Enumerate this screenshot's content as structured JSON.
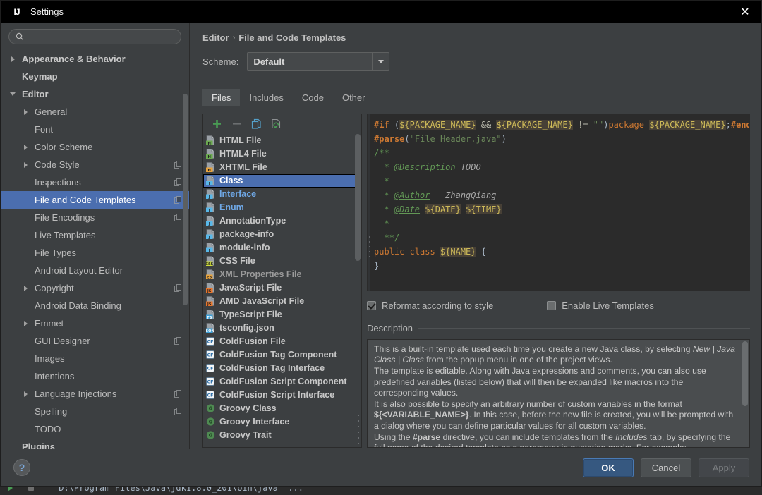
{
  "window": {
    "title": "Settings",
    "logo_text": "IJ",
    "close_icon": "close-icon"
  },
  "sidebar": {
    "search": {
      "value": "",
      "placeholder": ""
    },
    "items": [
      {
        "label": "Appearance & Behavior",
        "arrow": "right",
        "indent": 0,
        "bold": true,
        "copy": false,
        "selected": false
      },
      {
        "label": "Keymap",
        "arrow": "none",
        "indent": 0,
        "bold": true,
        "copy": false,
        "selected": false
      },
      {
        "label": "Editor",
        "arrow": "down",
        "indent": 0,
        "bold": true,
        "copy": false,
        "selected": false
      },
      {
        "label": "General",
        "arrow": "right",
        "indent": 1,
        "bold": false,
        "copy": false,
        "selected": false
      },
      {
        "label": "Font",
        "arrow": "none",
        "indent": 1,
        "bold": false,
        "copy": false,
        "selected": false
      },
      {
        "label": "Color Scheme",
        "arrow": "right",
        "indent": 1,
        "bold": false,
        "copy": false,
        "selected": false
      },
      {
        "label": "Code Style",
        "arrow": "right",
        "indent": 1,
        "bold": false,
        "copy": true,
        "selected": false
      },
      {
        "label": "Inspections",
        "arrow": "none",
        "indent": 1,
        "bold": false,
        "copy": true,
        "selected": false
      },
      {
        "label": "File and Code Templates",
        "arrow": "none",
        "indent": 1,
        "bold": false,
        "copy": true,
        "selected": true
      },
      {
        "label": "File Encodings",
        "arrow": "none",
        "indent": 1,
        "bold": false,
        "copy": true,
        "selected": false
      },
      {
        "label": "Live Templates",
        "arrow": "none",
        "indent": 1,
        "bold": false,
        "copy": false,
        "selected": false
      },
      {
        "label": "File Types",
        "arrow": "none",
        "indent": 1,
        "bold": false,
        "copy": false,
        "selected": false
      },
      {
        "label": "Android Layout Editor",
        "arrow": "none",
        "indent": 1,
        "bold": false,
        "copy": false,
        "selected": false
      },
      {
        "label": "Copyright",
        "arrow": "right",
        "indent": 1,
        "bold": false,
        "copy": true,
        "selected": false
      },
      {
        "label": "Android Data Binding",
        "arrow": "none",
        "indent": 1,
        "bold": false,
        "copy": false,
        "selected": false
      },
      {
        "label": "Emmet",
        "arrow": "right",
        "indent": 1,
        "bold": false,
        "copy": false,
        "selected": false
      },
      {
        "label": "GUI Designer",
        "arrow": "none",
        "indent": 1,
        "bold": false,
        "copy": true,
        "selected": false
      },
      {
        "label": "Images",
        "arrow": "none",
        "indent": 1,
        "bold": false,
        "copy": false,
        "selected": false
      },
      {
        "label": "Intentions",
        "arrow": "none",
        "indent": 1,
        "bold": false,
        "copy": false,
        "selected": false
      },
      {
        "label": "Language Injections",
        "arrow": "right",
        "indent": 1,
        "bold": false,
        "copy": true,
        "selected": false
      },
      {
        "label": "Spelling",
        "arrow": "none",
        "indent": 1,
        "bold": false,
        "copy": true,
        "selected": false
      },
      {
        "label": "TODO",
        "arrow": "none",
        "indent": 1,
        "bold": false,
        "copy": false,
        "selected": false
      },
      {
        "label": "Plugins",
        "arrow": "none",
        "indent": 0,
        "bold": true,
        "copy": false,
        "selected": false
      }
    ]
  },
  "header": {
    "breadcrumb_parent": "Editor",
    "breadcrumb_sep": "›",
    "breadcrumb_current": "File and Code Templates",
    "scheme_label": "Scheme:",
    "scheme_value": "Default",
    "scheme_arrow_icon": "chevron-down-icon"
  },
  "tabs": [
    {
      "label": "Files",
      "active": true
    },
    {
      "label": "Includes",
      "active": false
    },
    {
      "label": "Code",
      "active": false
    },
    {
      "label": "Other",
      "active": false
    }
  ],
  "list_toolbar": [
    {
      "name": "add-template-button",
      "icon": "plus-icon",
      "enabled": true
    },
    {
      "name": "remove-template-button",
      "icon": "minus-icon",
      "enabled": false
    },
    {
      "name": "copy-template-button",
      "icon": "copy-icon",
      "enabled": true
    },
    {
      "name": "reset-template-button",
      "icon": "reset-icon",
      "enabled": true
    }
  ],
  "templates": [
    {
      "label": "HTML File",
      "icon": "html-file-icon",
      "state": "normal",
      "selected": false
    },
    {
      "label": "HTML4 File",
      "icon": "html-file-icon",
      "state": "normal",
      "selected": false
    },
    {
      "label": "XHTML File",
      "icon": "xhtml-file-icon",
      "state": "normal",
      "selected": false
    },
    {
      "label": "Class",
      "icon": "java-file-icon",
      "state": "normal",
      "selected": true
    },
    {
      "label": "Interface",
      "icon": "java-file-icon",
      "state": "modified",
      "selected": false
    },
    {
      "label": "Enum",
      "icon": "java-file-icon",
      "state": "modified",
      "selected": false
    },
    {
      "label": "AnnotationType",
      "icon": "java-file-icon",
      "state": "normal",
      "selected": false
    },
    {
      "label": "package-info",
      "icon": "java-file-icon",
      "state": "normal",
      "selected": false
    },
    {
      "label": "module-info",
      "icon": "java-file-icon",
      "state": "normal",
      "selected": false
    },
    {
      "label": "CSS File",
      "icon": "css-file-icon",
      "state": "normal",
      "selected": false
    },
    {
      "label": "XML Properties File",
      "icon": "xml-file-icon",
      "state": "dim",
      "selected": false
    },
    {
      "label": "JavaScript File",
      "icon": "js-file-icon",
      "state": "normal",
      "selected": false
    },
    {
      "label": "AMD JavaScript File",
      "icon": "js-file-icon",
      "state": "normal",
      "selected": false
    },
    {
      "label": "TypeScript File",
      "icon": "ts-file-icon",
      "state": "normal",
      "selected": false
    },
    {
      "label": "tsconfig.json",
      "icon": "json-file-icon",
      "state": "normal",
      "selected": false
    },
    {
      "label": "ColdFusion File",
      "icon": "coldfusion-icon",
      "state": "normal",
      "selected": false
    },
    {
      "label": "ColdFusion Tag Component",
      "icon": "coldfusion-icon",
      "state": "normal",
      "selected": false
    },
    {
      "label": "ColdFusion Tag Interface",
      "icon": "coldfusion-icon",
      "state": "normal",
      "selected": false
    },
    {
      "label": "ColdFusion Script Component",
      "icon": "coldfusion-icon",
      "state": "normal",
      "selected": false
    },
    {
      "label": "ColdFusion Script Interface",
      "icon": "coldfusion-icon",
      "state": "normal",
      "selected": false
    },
    {
      "label": "Groovy Class",
      "icon": "groovy-icon",
      "state": "normal",
      "selected": false
    },
    {
      "label": "Groovy Interface",
      "icon": "groovy-icon",
      "state": "normal",
      "selected": false
    },
    {
      "label": "Groovy Trait",
      "icon": "groovy-icon",
      "state": "normal",
      "selected": false
    }
  ],
  "code": {
    "lines": [
      [
        {
          "t": "#if",
          "c": "dir"
        },
        {
          "t": " ",
          "c": "punct"
        },
        {
          "t": "(",
          "c": "punct"
        },
        {
          "t": "${PACKAGE_NAME}",
          "c": "var"
        },
        {
          "t": " ",
          "c": "punct"
        },
        {
          "t": "&&",
          "c": "op"
        },
        {
          "t": " ",
          "c": "punct"
        },
        {
          "t": "${PACKAGE_NAME}",
          "c": "var"
        },
        {
          "t": " ",
          "c": "punct"
        },
        {
          "t": "!=",
          "c": "op"
        },
        {
          "t": " ",
          "c": "punct"
        },
        {
          "t": "\"\"",
          "c": "str"
        },
        {
          "t": ")",
          "c": "punct"
        },
        {
          "t": "package ",
          "c": "kw"
        },
        {
          "t": "${PACKAGE_NAME}",
          "c": "var"
        },
        {
          "t": ";",
          "c": "punct"
        },
        {
          "t": "#end",
          "c": "dir"
        }
      ],
      [
        {
          "t": "#parse",
          "c": "dir"
        },
        {
          "t": "(",
          "c": "punct"
        },
        {
          "t": "\"File Header.java\"",
          "c": "str"
        },
        {
          "t": ")",
          "c": "punct"
        }
      ],
      [
        {
          "t": "/**",
          "c": "cmt"
        }
      ],
      [
        {
          "t": "  * ",
          "c": "cmt"
        },
        {
          "t": "@Description",
          "c": "tag"
        },
        {
          "t": " TODO",
          "c": "todo"
        }
      ],
      [
        {
          "t": "  *",
          "c": "cmt"
        }
      ],
      [
        {
          "t": "  * ",
          "c": "cmt"
        },
        {
          "t": "@Author",
          "c": "tag"
        },
        {
          "t": "   ZhangQiang",
          "c": "todo"
        }
      ],
      [
        {
          "t": "  * ",
          "c": "cmt"
        },
        {
          "t": "@Date",
          "c": "tag"
        },
        {
          "t": " ",
          "c": "punct"
        },
        {
          "t": "${DATE}",
          "c": "var"
        },
        {
          "t": " ",
          "c": "punct"
        },
        {
          "t": "${TIME}",
          "c": "var"
        }
      ],
      [
        {
          "t": "  *",
          "c": "cmt"
        }
      ],
      [
        {
          "t": "  **/",
          "c": "cmt"
        }
      ],
      [
        {
          "t": "public class ",
          "c": "kw"
        },
        {
          "t": "${NAME}",
          "c": "var"
        },
        {
          "t": " {",
          "c": "punct"
        }
      ],
      [
        {
          "t": "}",
          "c": "punct"
        }
      ]
    ]
  },
  "options": {
    "reformat": {
      "label_before": "R",
      "label_after": "eformat according to style",
      "checked": true
    },
    "live_templates": {
      "label_before": "Enable L",
      "label_after": "ive Templates",
      "checked": false
    }
  },
  "description": {
    "title": "Description",
    "paragraphs": [
      [
        {
          "t": "This is a built-in template used each time you create a new Java class, by selecting ",
          "s": "n"
        },
        {
          "t": "New | Java Class | Class",
          "s": "i"
        },
        {
          "t": " from the popup menu in one of the project views.",
          "s": "n"
        }
      ],
      [
        {
          "t": "The template is editable. Along with Java expressions and comments, you can also use predefined variables (listed below) that will then be expanded like macros into the corresponding values.",
          "s": "n"
        }
      ],
      [
        {
          "t": "It is also possible to specify an arbitrary number of custom variables in the format ",
          "s": "n"
        },
        {
          "t": "${<VARIABLE_NAME>}",
          "s": "b"
        },
        {
          "t": ". In this case, before the new file is created, you will be prompted with a dialog where you can define particular values for all custom variables.",
          "s": "n"
        }
      ],
      [
        {
          "t": "Using the ",
          "s": "n"
        },
        {
          "t": "#parse",
          "s": "b"
        },
        {
          "t": " directive, you can include templates from the ",
          "s": "n"
        },
        {
          "t": "Includes",
          "s": "i"
        },
        {
          "t": " tab, by specifying the full name of the desired template as a parameter in quotation marks. For example:",
          "s": "n"
        }
      ]
    ]
  },
  "footer": {
    "help_label": "?",
    "ok_label": "OK",
    "cancel_label": "Cancel",
    "apply_label": "Apply"
  },
  "background": {
    "console_text": "\"D:\\Program Files\\Java\\jdk1.8.0_201\\bin\\java\" ..."
  },
  "colors": {
    "accent": "#4b6eaf",
    "ok_button": "#365880",
    "modified_template": "#6fa8e6",
    "dialog_bg": "#3c3f41",
    "editor_bg": "#2b2b2b"
  }
}
